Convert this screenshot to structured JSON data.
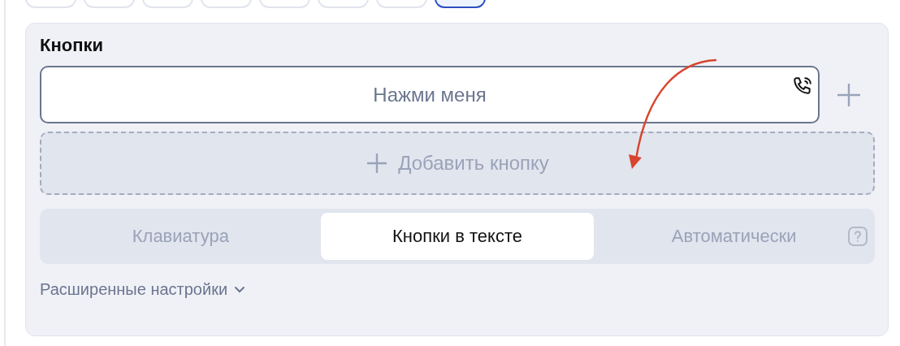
{
  "chips": [
    {
      "selected": false
    },
    {
      "selected": false
    },
    {
      "selected": false
    },
    {
      "selected": false
    },
    {
      "selected": false
    },
    {
      "selected": false
    },
    {
      "selected": false
    },
    {
      "selected": true
    }
  ],
  "card": {
    "title": "Кнопки",
    "buttons": [
      {
        "label": "Нажми меня",
        "kind": "phone"
      }
    ],
    "add_button": {
      "label": "Добавить кнопку"
    },
    "keyboard_modes": [
      {
        "label": "Клавиатура",
        "selected": false
      },
      {
        "label": "Кнопки в тексте",
        "selected": true
      },
      {
        "label": "Автоматически",
        "selected": false
      }
    ],
    "advanced": {
      "label": "Расширенные настройки",
      "expanded": false
    }
  }
}
